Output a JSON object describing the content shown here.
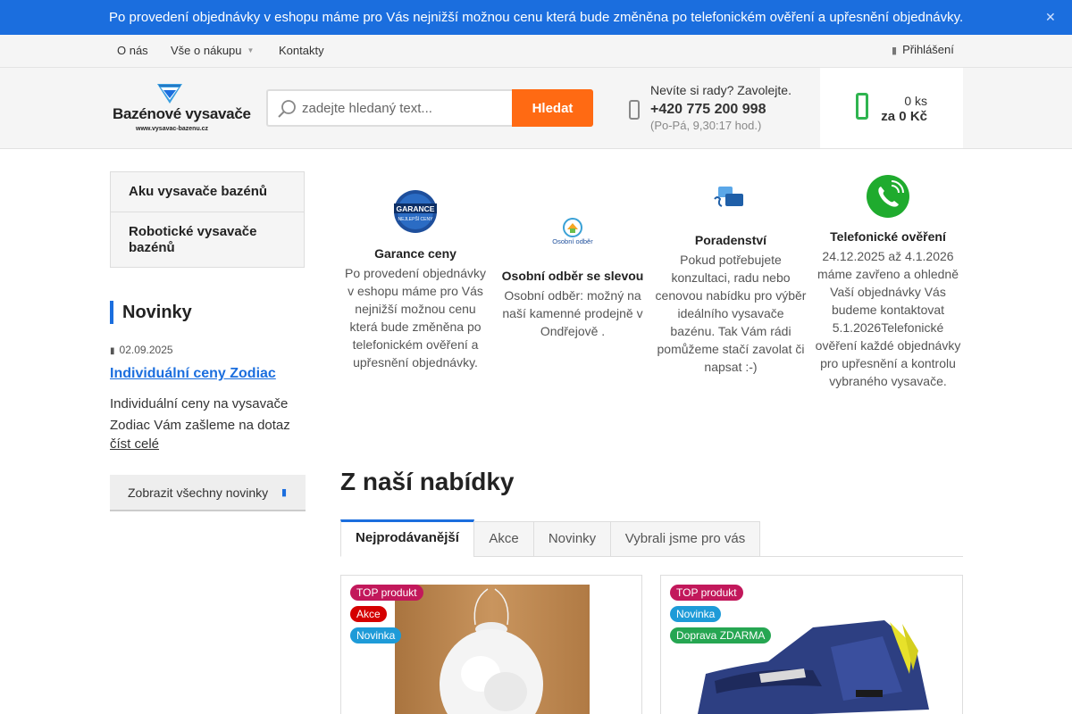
{
  "banner": {
    "text": "Po provedení objednávky v eshopu máme pro Vás nejnižší možnou cenu která bude změněna po telefonickém ověření a upřesnění objednávky.",
    "close_icon": "close-icon"
  },
  "topnav": {
    "items": [
      {
        "label": "O nás"
      },
      {
        "label": "Vše o nákupu",
        "has_dropdown": true
      },
      {
        "label": "Kontakty"
      }
    ],
    "login_label": "Přihlášení"
  },
  "header": {
    "logo_text": "Bazénové vysavače",
    "logo_url": "www.vysavac-bazenu.cz",
    "search_placeholder": "zadejte hledaný text...",
    "search_button": "Hledat",
    "help_line1": "Nevíte si rady? Zavolejte.",
    "help_phone": "+420 775 200 998",
    "help_hours": "(Po-Pá, 9,30:17 hod.)",
    "cart_count": "0 ks",
    "cart_total": "za 0 Kč"
  },
  "sidebar": {
    "categories": [
      {
        "label": "Aku vysavače bazénů"
      },
      {
        "label": "Robotické vysavače bazénů"
      }
    ],
    "news_heading": "Novinky",
    "news_date": "02.09.2025",
    "news_title": "Individuální ceny Zodiac",
    "news_text": "Individuální ceny na vysavače Zodiac Vám zašleme na dotaz",
    "news_more": "číst celé",
    "news_all_button": "Zobrazit všechny novinky"
  },
  "benefits": [
    {
      "title": "Garance ceny",
      "text": "Po provedení objednávky v eshopu máme pro Vás nejnižší možnou cenu která bude změněna po telefonickém ověření a upřesnění objednávky.",
      "badge_text": "GARANCE",
      "badge_sub": "NEJLEPŠÍ CENY"
    },
    {
      "title": "Osobní odběr se slevou",
      "text": "Osobní odběr: možný na naší kamenné prodejně v Ondřejově .",
      "logo_text": "Osobní odběr"
    },
    {
      "title": "Poradenství",
      "text": "Pokud potřebujete konzultaci, radu nebo cenovou nabídku pro výběr ideálního vysavače bazénu. Tak Vám rádi pomůžeme stačí zavolat či napsat :-)"
    },
    {
      "title": "Telefonické ověření",
      "text": "24.12.2025 až 4.1.2026 máme zavřeno a ohledně Vaší objednávky Vás budeme kontaktovat 5.1.2026Telefonické ověření každé objednávky pro upřesnění a kontrolu vybraného vysavače."
    }
  ],
  "offers": {
    "heading": "Z naší nabídky",
    "tabs": [
      {
        "label": "Nejprodávanější",
        "active": true
      },
      {
        "label": "Akce"
      },
      {
        "label": "Novinky"
      },
      {
        "label": "Vybrali jsme pro vás"
      }
    ],
    "products": [
      {
        "flags": [
          "TOP produkt",
          "Akce",
          "Novinka"
        ]
      },
      {
        "flags": [
          "TOP produkt",
          "Novinka",
          "Doprava ZDARMA"
        ]
      }
    ]
  },
  "colors": {
    "brand_blue": "#1b6ede",
    "search_orange": "#ff6a13",
    "cart_green": "#2fb450",
    "flag_top": "#c2185b",
    "flag_akce": "#d50000",
    "flag_novinka": "#1e9bd8",
    "flag_zdarma": "#26a652"
  }
}
